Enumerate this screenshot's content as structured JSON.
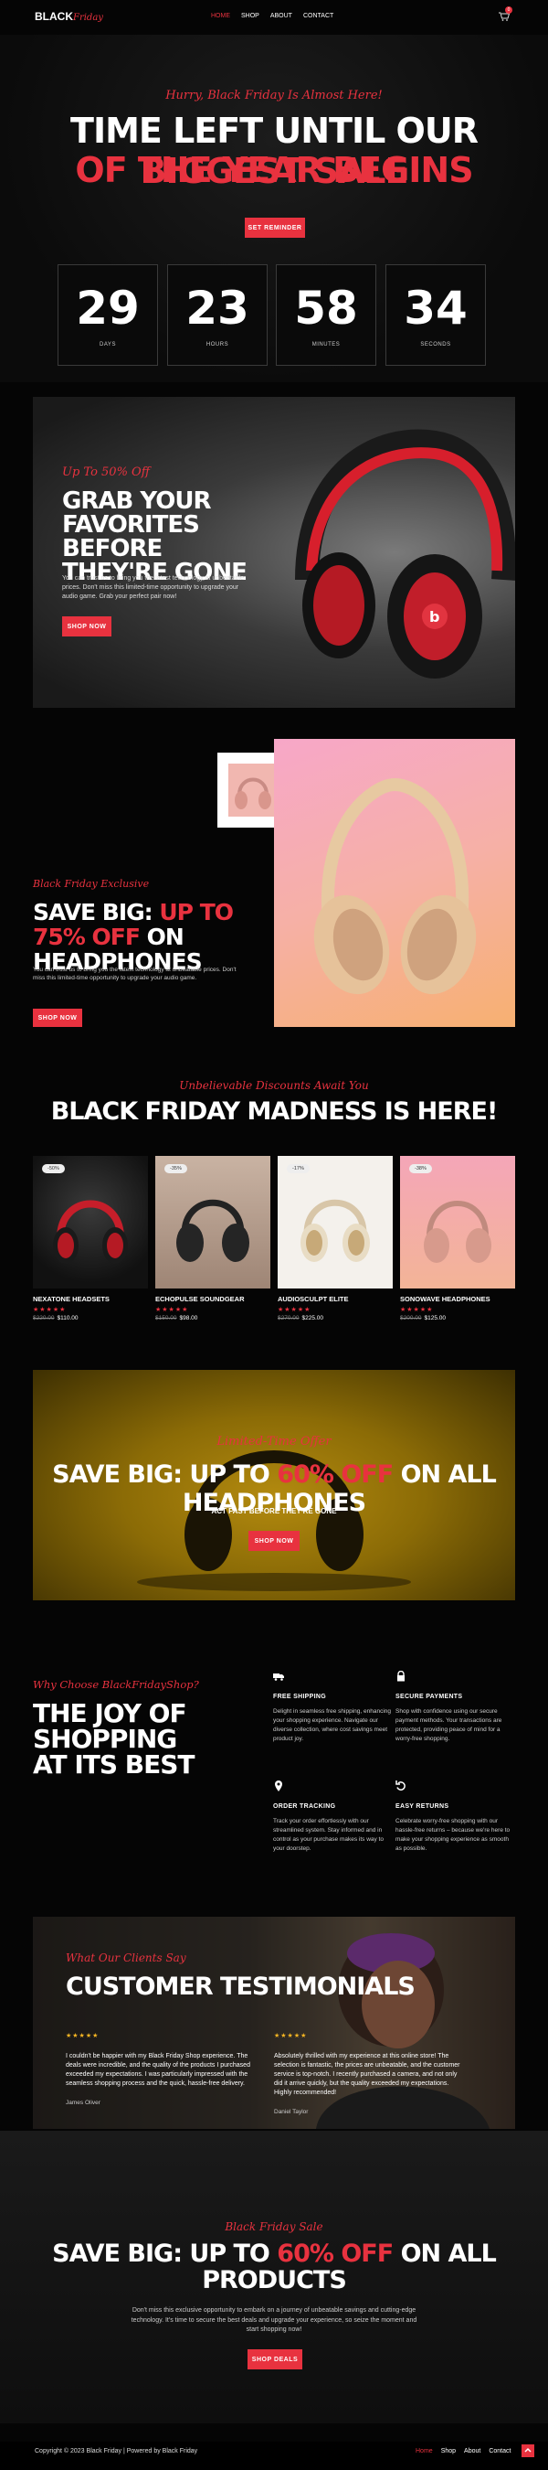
{
  "header": {
    "logo_main": "BLACK",
    "logo_script": "Friday",
    "nav": [
      "HOME",
      "SHOP",
      "ABOUT",
      "CONTACT"
    ],
    "cart_count": "0"
  },
  "hero": {
    "kicker": "Hurry, Black Friday Is Almost Here!",
    "title_white": "TIME LEFT UNTIL OUR ",
    "title_red1": "BIGGEST SALE",
    "title_red2": "OF THE YEAR BEGINS",
    "button": "SET REMINDER",
    "countdown": [
      {
        "value": "29",
        "label": "DAYS"
      },
      {
        "value": "23",
        "label": "HOURS"
      },
      {
        "value": "58",
        "label": "MINUTES"
      },
      {
        "value": "34",
        "label": "SECONDS"
      }
    ]
  },
  "promo1": {
    "kicker": "Up To 50% Off",
    "title": "GRAB YOUR FAVORITES BEFORE THEY'RE GONE",
    "text": "You can trust us to bring you the latest technology at unbeatable prices. Don't miss this limited-time opportunity to upgrade your audio game. Grab your perfect pair now!",
    "button": "SHOP NOW"
  },
  "promo2": {
    "kicker": "Black Friday Exclusive",
    "title_white1": "SAVE BIG: ",
    "title_red": "UP TO 75% OFF",
    "title_white2": " ON HEADPHONES",
    "text": "You can trust us to bring you the latest technology at unbeatable prices. Don't miss this limited-time opportunity to upgrade your audio game.",
    "button": "SHOP NOW"
  },
  "products": {
    "kicker": "Unbelievable Discounts Await You",
    "title": "BLACK FRIDAY MADNESS IS HERE!",
    "items": [
      {
        "badge": "-50%",
        "name": "NEXATONE HEADSETS",
        "stars": "★★★★★",
        "old": "$220.00",
        "price": "$110.00"
      },
      {
        "badge": "-35%",
        "name": "ECHOPULSE SOUNDGEAR",
        "stars": "★★★★★",
        "old": "$150.00",
        "price": "$98.00"
      },
      {
        "badge": "-17%",
        "name": "AUDIOSCULPT ELITE",
        "stars": "★★★★★",
        "old": "$270.00",
        "price": "$225.00"
      },
      {
        "badge": "-38%",
        "name": "SONOWAVE HEADPHONES",
        "stars": "★★★★★",
        "old": "$200.00",
        "price": "$125.00"
      }
    ]
  },
  "banner": {
    "kicker": "Limited-Time Offer",
    "title_white1": "SAVE BIG: UP TO ",
    "title_red": "60% OFF",
    "title_white2": " ON ALL HEADPHONES",
    "sub": "ACT FAST BEFORE THEY'RE GONE",
    "button": "SHOP NOW"
  },
  "why": {
    "kicker": "Why Choose BlackFridayShop?",
    "title": "THE JOY OF SHOPPING AT ITS BEST",
    "features": [
      {
        "icon": "truck-icon",
        "title": "FREE SHIPPING",
        "text": "Delight in seamless free shipping, enhancing your shopping experience. Navigate our diverse collection, where cost savings meet product joy."
      },
      {
        "icon": "lock-icon",
        "title": "SECURE PAYMENTS",
        "text": "Shop with confidence using our secure payment methods. Your transactions are protected, providing peace of mind for a worry-free shopping."
      },
      {
        "icon": "location-pin-icon",
        "title": "ORDER TRACKING",
        "text": "Track your order effortlessly with our streamlined system. Stay informed and in control as your purchase makes its way to your doorstep."
      },
      {
        "icon": "return-arrow-icon",
        "title": "EASY RETURNS",
        "text": "Celebrate worry-free shopping with our hassle-free returns – because we're here to make your shopping experience as smooth as possible."
      }
    ]
  },
  "testimonials": {
    "kicker": "What Our Clients Say",
    "title": "CUSTOMER TESTIMONIALS",
    "items": [
      {
        "stars": "★★★★★",
        "quote": "I couldn't be happier with my Black Friday Shop experience. The deals were incredible, and the quality of the products I purchased exceeded my expectations. I was particularly impressed with the seamless shopping process and the quick, hassle-free delivery.",
        "name": "James Oliver"
      },
      {
        "stars": "★★★★★",
        "quote": "Absolutely thrilled with my experience at this online store! The selection is fantastic, the prices are unbeatable, and the customer service is top-notch. I recently purchased a camera, and not only did it arrive quickly, but the quality exceeded my expectations. Highly recommended!",
        "name": "Daniel Taylor"
      }
    ]
  },
  "cta": {
    "kicker": "Black Friday Sale",
    "title_white1": "SAVE BIG: UP TO ",
    "title_red": "60% OFF",
    "title_white2": " ON ALL",
    "title_line2": "PRODUCTS",
    "text": "Don't miss this exclusive opportunity to embark on a journey of unbeatable savings and cutting-edge technology. It's time to secure the best deals and upgrade your experience, so seize the moment and start shopping now!",
    "button": "SHOP DEALS"
  },
  "footer": {
    "copyright": "Copyright © 2023 Black Friday | Powered by Black Friday",
    "nav": [
      "Home",
      "Shop",
      "About",
      "Contact"
    ]
  },
  "colors": {
    "accent": "#e8323f",
    "background": "#050505"
  }
}
